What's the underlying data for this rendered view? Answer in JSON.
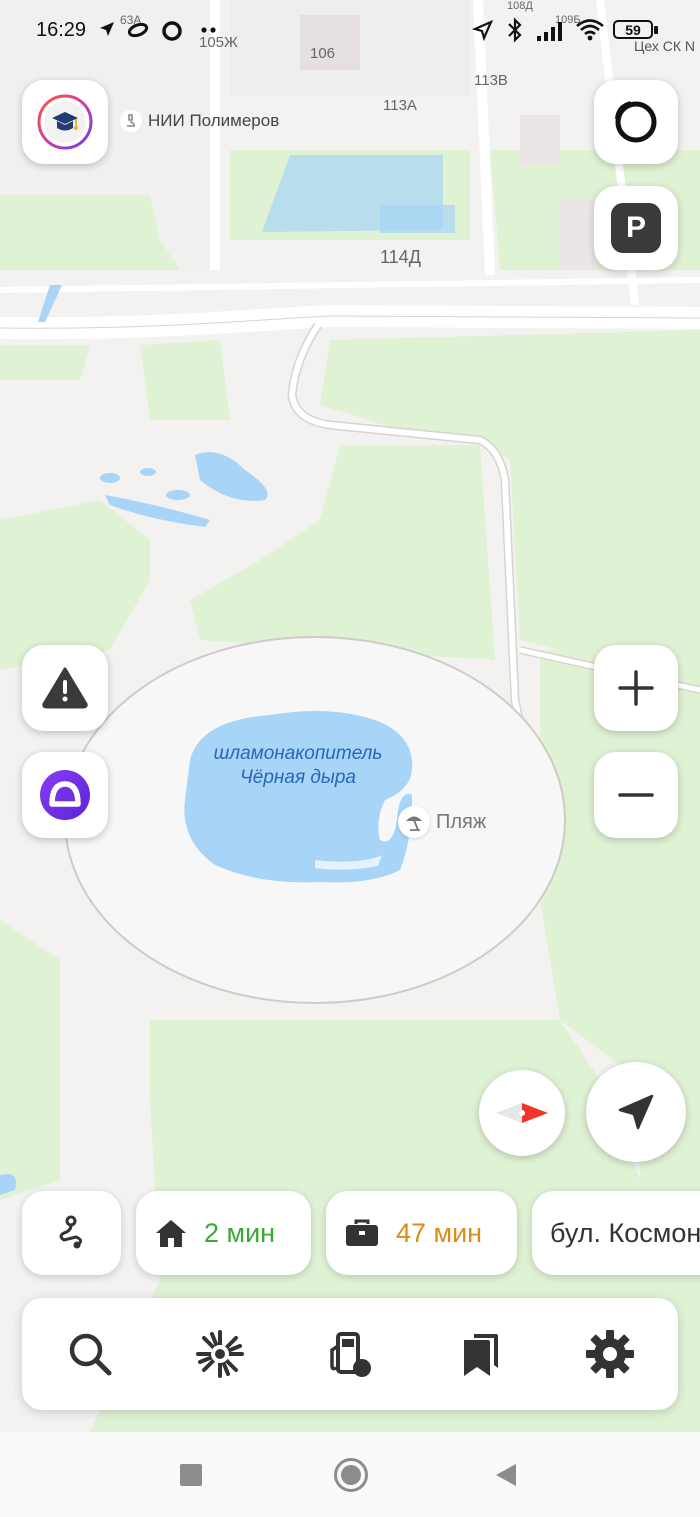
{
  "status_bar": {
    "time": "16:29",
    "battery": "59",
    "icons": [
      "location-arrow-icon",
      "cloud-icon",
      "circle-icon",
      "dots-icon",
      "location-icon",
      "bluetooth-icon",
      "signal-icon",
      "wifi-icon",
      "battery-icon"
    ]
  },
  "map": {
    "building_labels": [
      "105Ж",
      "106",
      "113В",
      "113А",
      "114Д",
      "63А",
      "108Д",
      "109Б"
    ],
    "poi_label": "НИИ Полимеров",
    "corner_label": "Цех СК N",
    "lake_name_line1": "шламонакопитель",
    "lake_name_line2": "Чёрная дыра",
    "beach_label": "Пляж",
    "colors": {
      "water": "#a7d4f7",
      "park": "#e0f2d4",
      "ground": "#f3f2f0",
      "road": "#ffffff"
    }
  },
  "controls": {
    "profile": "graduation-cap-icon",
    "alice_top": "alice-ring-icon",
    "parking": "P",
    "warning": "warning-icon",
    "alice": "alice-icon",
    "zoom_in": "plus-icon",
    "zoom_out": "minus-icon",
    "compass": "compass-icon",
    "my_location": "navigation-arrow-icon"
  },
  "shortcuts": {
    "route": "route-icon",
    "home_time": "2 мин",
    "work_time": "47 мин",
    "address": "бул. Космонавтов",
    "colors": {
      "home": "#3aa935",
      "work": "#d98c1a"
    }
  },
  "toolbar": {
    "items": [
      "search-icon",
      "discovery-icon",
      "fuel-icon",
      "bookmarks-icon",
      "settings-icon"
    ]
  },
  "navbar": {
    "items": [
      "recents-button",
      "home-button",
      "back-button"
    ]
  }
}
